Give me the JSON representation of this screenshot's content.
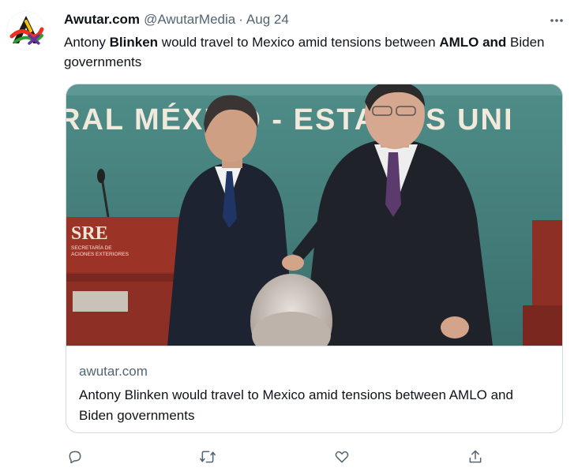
{
  "tweet": {
    "display_name": "Awutar.com",
    "handle": "@AwutarMedia",
    "separator": "·",
    "date": "Aug 24",
    "text": {
      "part1": "Antony ",
      "bold1": "Blinken",
      "part2": " would travel to Mexico amid tensions between ",
      "bold2": "AMLO and",
      "part3": " Biden governments"
    }
  },
  "card": {
    "image": {
      "banner_text": "RAL MÉXICO - ESTADOS UNI",
      "podium_logo": "SRE",
      "podium_sub1": "SECRETARÍA DE",
      "podium_sub2": "ACIONES EXTERIORES"
    },
    "domain": "awutar.com",
    "title": "Antony Blinken would travel to Mexico amid tensions between AMLO and Biden governments"
  },
  "actions": {
    "reply_icon": "reply-icon",
    "retweet_icon": "retweet-icon",
    "like_icon": "heart-icon",
    "share_icon": "share-icon"
  },
  "colors": {
    "text": "#0f1419",
    "secondary": "#536471",
    "border": "#cfd9de",
    "backdrop": "#4d8a86"
  }
}
